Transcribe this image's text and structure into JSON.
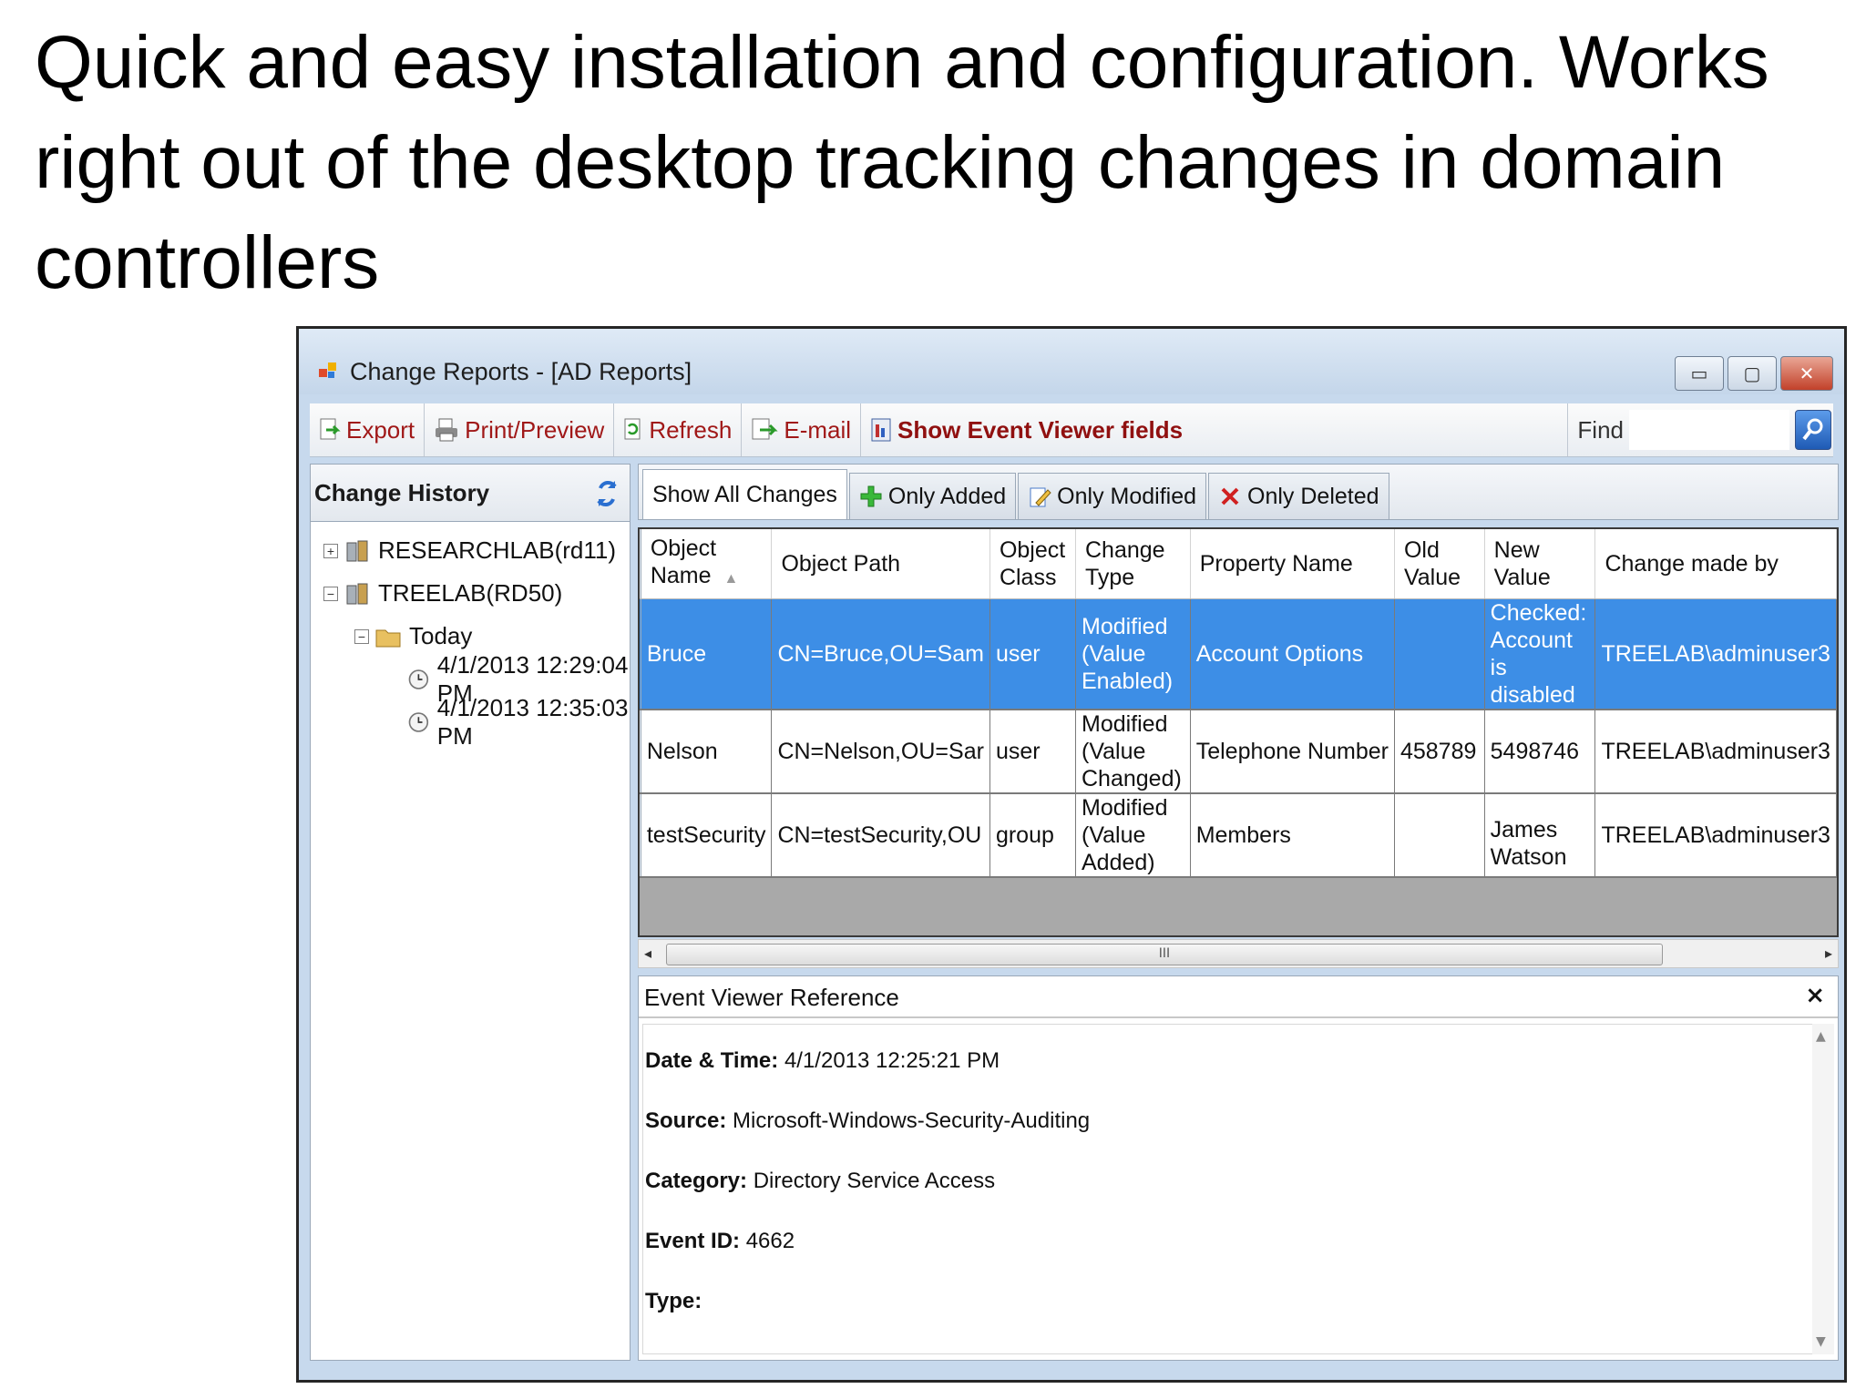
{
  "heading": "Quick and easy installation and configuration. Works right out of the desktop tracking changes in domain controllers",
  "window": {
    "title": "Change Reports - [AD Reports]",
    "controls": {
      "minimize": "▭",
      "maximize": "▢",
      "close": "✕"
    }
  },
  "toolbar": {
    "export_label": "Export",
    "print_label": "Print/Preview",
    "refresh_label": "Refresh",
    "email_label": "E-mail",
    "event_viewer_label": "Show Event Viewer fields",
    "find_label": "Find",
    "find_value": ""
  },
  "left_panel": {
    "title": "Change History",
    "tree": [
      {
        "label": "RESEARCHLAB(rd11)",
        "expander": "+"
      },
      {
        "label": "TREELAB(RD50)",
        "expander": "−"
      },
      {
        "label": "Today",
        "expander": "−"
      },
      {
        "label": "4/1/2013 12:29:04 PM"
      },
      {
        "label": "4/1/2013 12:35:03 PM"
      }
    ]
  },
  "tabs": [
    {
      "label": "Show All Changes"
    },
    {
      "label": "Only Added"
    },
    {
      "label": "Only Modified"
    },
    {
      "label": "Only Deleted"
    }
  ],
  "grid": {
    "columns": [
      "Object Name",
      "Object Path",
      "Object Class",
      "Change Type",
      "Property Name",
      "Old Value",
      "New Value",
      "Change made by"
    ],
    "rows": [
      [
        "Bruce",
        "CN=Bruce,OU=Sam",
        "user",
        "Modified (Value Enabled)",
        "Account Options",
        "",
        "Checked: Account is disabled",
        "TREELAB\\adminuser3"
      ],
      [
        "Nelson",
        "CN=Nelson,OU=Sar",
        "user",
        "Modified (Value Changed)",
        "Telephone Number",
        "458789",
        "5498746",
        "TREELAB\\adminuser3"
      ],
      [
        "testSecurity",
        "CN=testSecurity,OU",
        "group",
        "Modified (Value Added)",
        "Members",
        "",
        "James Watson",
        "TREELAB\\adminuser3"
      ]
    ],
    "scroll_thumb": "III"
  },
  "event_panel": {
    "title": "Event Viewer Reference",
    "close": "×",
    "fields": [
      {
        "label": "Date & Time:",
        "value": "4/1/2013 12:25:21 PM"
      },
      {
        "label": "Source:",
        "value": "Microsoft-Windows-Security-Auditing"
      },
      {
        "label": "Category:",
        "value": "Directory Service Access"
      },
      {
        "label": "Event ID:",
        "value": "4662"
      },
      {
        "label": "Type:",
        "value": ""
      }
    ]
  },
  "colors": {
    "selection": "#3d8ee6",
    "toolbar_text": "#a01818",
    "grid_background": "#a9a9a9"
  },
  "icons": [
    "app-icon",
    "export-icon",
    "print-icon",
    "refresh-icon",
    "email-icon",
    "event-viewer-icon",
    "search-icon",
    "server-icon",
    "folder-icon",
    "clock-icon",
    "add-icon",
    "modify-icon",
    "delete-icon",
    "close-icon"
  ]
}
